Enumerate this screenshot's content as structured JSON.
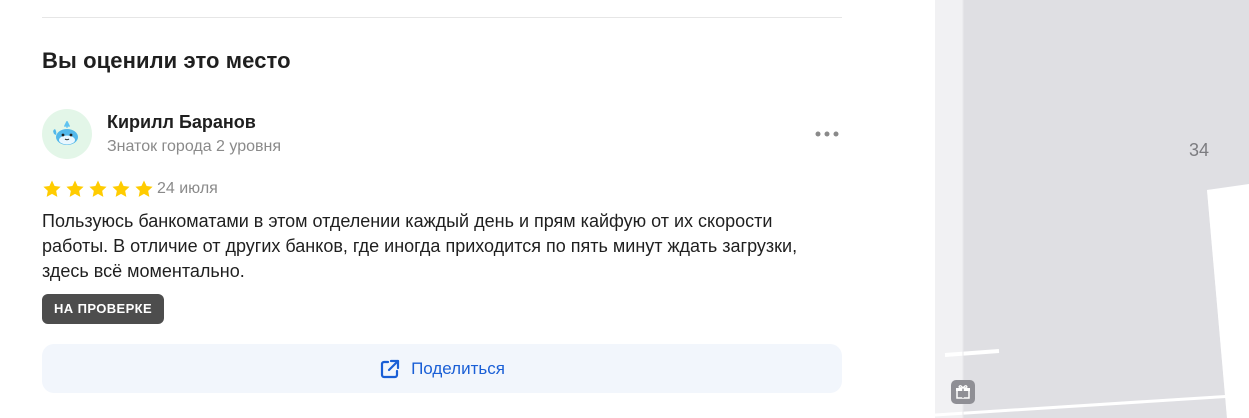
{
  "section": {
    "title": "Вы оценили это место"
  },
  "review": {
    "author_name": "Кирилл Баранов",
    "author_level": "Знаток города 2 уровня",
    "rating": 5,
    "rating_max": 5,
    "date": "24 июля",
    "text": "Пользуюсь банкоматами в этом отделении каждый день и прям кайфую от их скорости работы. В отличие от других банков, где иногда приходится по пять минут ждать загрузки, здесь всё моментально.",
    "status_badge": "НА ПРОВЕРКЕ",
    "more_icon": "more-horizontal-icon",
    "avatar_icon": "whale-icon"
  },
  "share": {
    "label": "Поделиться",
    "icon": "share-external-icon"
  },
  "map": {
    "house_number": "34",
    "poi_icon": "gift-icon"
  },
  "colors": {
    "star": "#FFCC00",
    "share_text": "#1A5FD6",
    "share_bg": "#F2F6FC",
    "badge_bg": "#4D4D4D",
    "avatar_bg": "#E3F6E8"
  }
}
